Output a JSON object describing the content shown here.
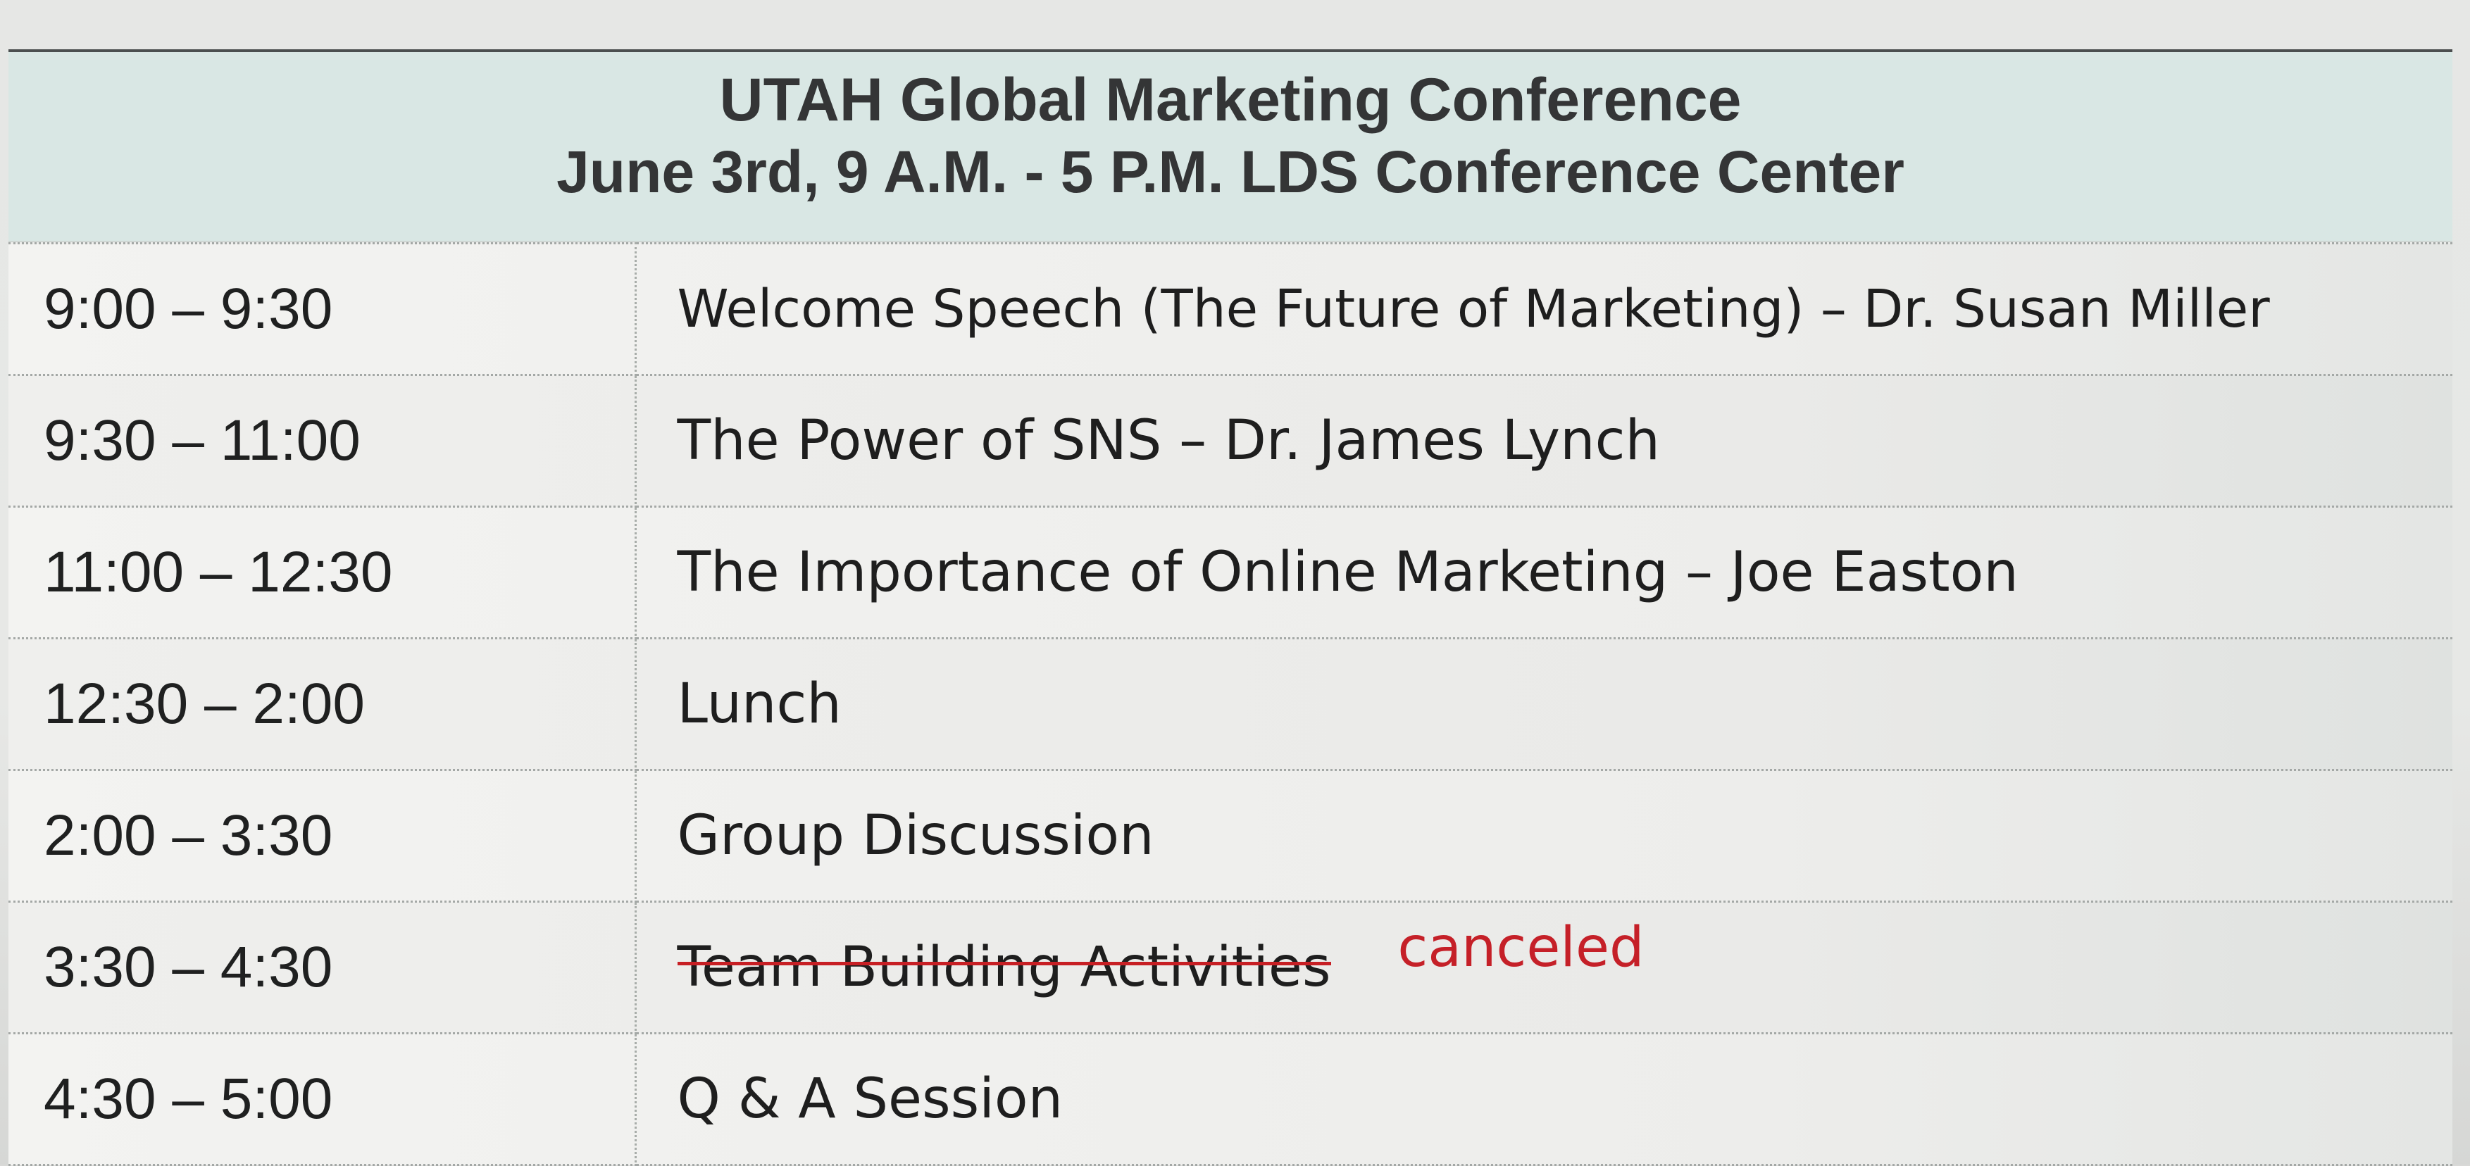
{
  "header": {
    "title": "UTAH Global Marketing Conference",
    "subtitle": "June 3rd, 9 A.M. - 5 P.M. LDS Conference Center"
  },
  "schedule": [
    {
      "time": "9:00 – 9:30",
      "event": "Welcome Speech (The Future of Marketing) – Dr. Susan Miller"
    },
    {
      "time": "9:30 – 11:00",
      "event": "The Power of SNS – Dr. James Lynch"
    },
    {
      "time": "11:00 – 12:30",
      "event": "The Importance of Online Marketing – Joe Easton"
    },
    {
      "time": "12:30 – 2:00",
      "event": "Lunch"
    },
    {
      "time": "2:00 – 3:30",
      "event": "Group Discussion"
    },
    {
      "time": "3:30 – 4:30",
      "event": "Team Building Activities",
      "status": "canceled"
    },
    {
      "time": "4:30 – 5:00",
      "event": "Q & A Session"
    }
  ],
  "colors": {
    "header_background": "#d9e7e4",
    "canceled_red": "#c52028",
    "grid_line": "#a4a8a6"
  }
}
